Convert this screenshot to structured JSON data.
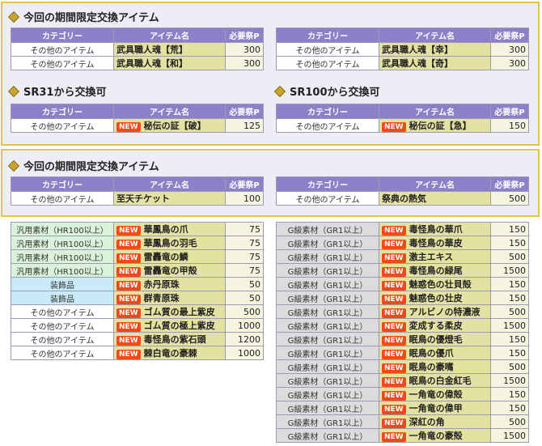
{
  "badge": "NEW",
  "section1": {
    "title": "今回の期間限定交換アイテム",
    "headers": [
      "カテゴリー",
      "アイテム名",
      "必要祭P"
    ],
    "left": [
      {
        "cat": "その他のアイテム",
        "name": "武具職人魂【荒】",
        "pts": "300"
      },
      {
        "cat": "その他のアイテム",
        "name": "武具職人魂【和】",
        "pts": "300"
      }
    ],
    "right": [
      {
        "cat": "その他のアイテム",
        "name": "武具職人魂【幸】",
        "pts": "300"
      },
      {
        "cat": "その他のアイテム",
        "name": "武具職人魂【奇】",
        "pts": "300"
      }
    ]
  },
  "section2": {
    "title_left": "SR31から交換可",
    "title_right": "SR100から交換可",
    "left": [
      {
        "cat": "その他のアイテム",
        "name": "秘伝の証【破】",
        "pts": "125"
      }
    ],
    "right": [
      {
        "cat": "その他のアイテム",
        "name": "秘伝の証【急】",
        "pts": "150"
      }
    ]
  },
  "section3": {
    "title": "今回の期間限定交換アイテム",
    "left": [
      {
        "cat": "その他のアイテム",
        "name": "至天チケット",
        "pts": "100"
      }
    ],
    "right": [
      {
        "cat": "その他のアイテム",
        "name": "祭典の熱気",
        "pts": "500"
      }
    ]
  },
  "list_left": [
    {
      "cat": "汎用素材（HR100以上）",
      "name": "華鳳鳥の爪",
      "pts": "75",
      "tone": "green"
    },
    {
      "cat": "汎用素材（HR100以上）",
      "name": "華鳳鳥の羽毛",
      "pts": "75",
      "tone": "green"
    },
    {
      "cat": "汎用素材（HR100以上）",
      "name": "雷轟竜の鱗",
      "pts": "75",
      "tone": "green"
    },
    {
      "cat": "汎用素材（HR100以上）",
      "name": "雷轟竜の甲殻",
      "pts": "75",
      "tone": "green"
    },
    {
      "cat": "装飾品",
      "name": "赤丹原珠",
      "pts": "50",
      "tone": "blue"
    },
    {
      "cat": "装飾品",
      "name": "群青原珠",
      "pts": "50",
      "tone": "blue"
    },
    {
      "cat": "その他のアイテム",
      "name": "ゴム質の最上紫皮",
      "pts": "500",
      "tone": "white"
    },
    {
      "cat": "その他のアイテム",
      "name": "ゴム質の極上紫皮",
      "pts": "1000",
      "tone": "white"
    },
    {
      "cat": "その他のアイテム",
      "name": "毒怪鳥の紫石頭",
      "pts": "1200",
      "tone": "white"
    },
    {
      "cat": "その他のアイテム",
      "name": "棘白竜の豪棘",
      "pts": "1000",
      "tone": "white"
    }
  ],
  "list_right": [
    {
      "cat": "G級素材（GR1以上）",
      "name": "毒怪鳥の華爪",
      "pts": "150"
    },
    {
      "cat": "G級素材（GR1以上）",
      "name": "毒怪鳥の華皮",
      "pts": "150"
    },
    {
      "cat": "G級素材（GR1以上）",
      "name": "激主エキス",
      "pts": "500"
    },
    {
      "cat": "G級素材（GR1以上）",
      "name": "毒怪鳥の緑尾",
      "pts": "1500"
    },
    {
      "cat": "G級素材（GR1以上）",
      "name": "魅惑色の壮貝殻",
      "pts": "150"
    },
    {
      "cat": "G級素材（GR1以上）",
      "name": "魅惑色の壮皮",
      "pts": "150"
    },
    {
      "cat": "G級素材（GR1以上）",
      "name": "アルビノの特濃液",
      "pts": "500"
    },
    {
      "cat": "G級素材（GR1以上）",
      "name": "変成する柔皮",
      "pts": "1500"
    },
    {
      "cat": "G級素材（GR1以上）",
      "name": "眠鳥の優燈毛",
      "pts": "150"
    },
    {
      "cat": "G級素材（GR1以上）",
      "name": "眠鳥の優爪",
      "pts": "150"
    },
    {
      "cat": "G級素材（GR1以上）",
      "name": "眠鳥の豪嘴",
      "pts": "500"
    },
    {
      "cat": "G級素材（GR1以上）",
      "name": "眠鳥の白金紅毛",
      "pts": "1500"
    },
    {
      "cat": "G級素材（GR1以上）",
      "name": "一角竜の偉殻",
      "pts": "150"
    },
    {
      "cat": "G級素材（GR1以上）",
      "name": "一角竜の偉甲",
      "pts": "150"
    },
    {
      "cat": "G級素材（GR1以上）",
      "name": "深紅の角",
      "pts": "500"
    },
    {
      "cat": "G級素材（GR1以上）",
      "name": "一角竜の豪殻",
      "pts": "1500"
    }
  ]
}
